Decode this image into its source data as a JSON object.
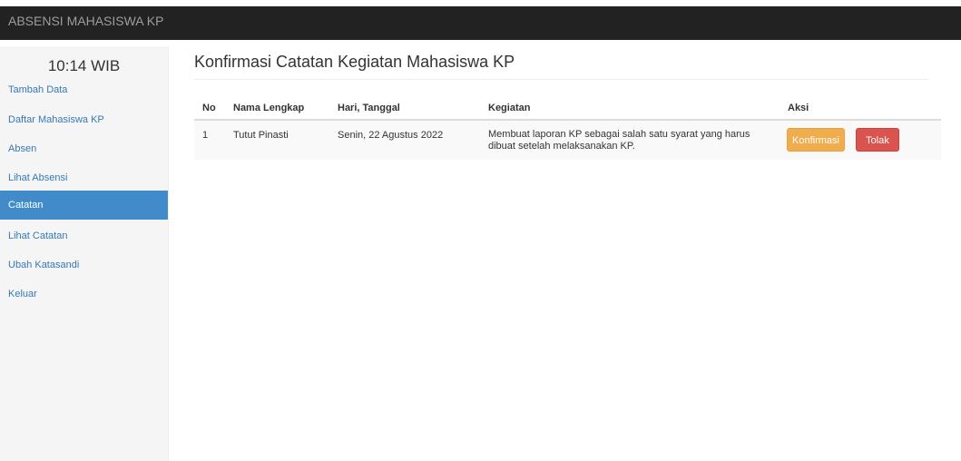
{
  "navbar": {
    "brand": "ABSENSI MAHASISWA KP"
  },
  "sidebar": {
    "clock": "10:14 WIB",
    "items": [
      {
        "label": "Tambah Data",
        "active": false
      },
      {
        "label": "Daftar Mahasiswa KP",
        "active": false
      },
      {
        "label": "Absen",
        "active": false
      },
      {
        "label": "Lihat Absensi",
        "active": false
      },
      {
        "label": "Catatan",
        "active": true
      },
      {
        "label": "Lihat Catatan",
        "active": false
      },
      {
        "label": "Ubah Katasandi",
        "active": false
      },
      {
        "label": "Keluar",
        "active": false
      }
    ]
  },
  "main": {
    "title": "Konfirmasi Catatan Kegiatan Mahasiswa KP",
    "table": {
      "headers": [
        "No",
        "Nama Lengkap",
        "Hari, Tanggal",
        "Kegiatan",
        "Aksi"
      ],
      "rows": [
        {
          "no": "1",
          "nama": "Tutut Pinasti",
          "tanggal": "Senin, 22 Agustus 2022",
          "kegiatan_line1": "Membuat laporan KP sebagai salah satu syarat yang harus",
          "kegiatan_line2": "dibuat setelah melaksanakan KP.",
          "confirm_label": "Konfirmasi",
          "reject_label": "Tolak"
        }
      ]
    }
  },
  "colors": {
    "navbar_bg": "#222222",
    "sidebar_bg": "#f5f5f5",
    "active_bg": "#428bca",
    "link": "#337ab7",
    "warning": "#f0ad4e",
    "danger": "#d9534f"
  }
}
